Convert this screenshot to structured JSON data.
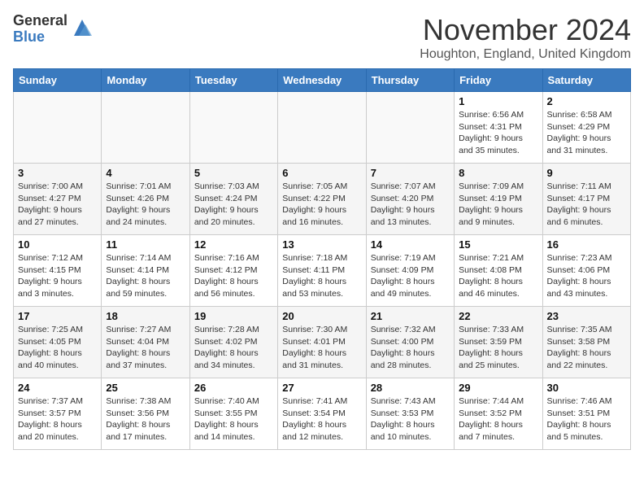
{
  "logo": {
    "general": "General",
    "blue": "Blue"
  },
  "title": "November 2024",
  "location": "Houghton, England, United Kingdom",
  "headers": [
    "Sunday",
    "Monday",
    "Tuesday",
    "Wednesday",
    "Thursday",
    "Friday",
    "Saturday"
  ],
  "weeks": [
    [
      {
        "day": "",
        "info": ""
      },
      {
        "day": "",
        "info": ""
      },
      {
        "day": "",
        "info": ""
      },
      {
        "day": "",
        "info": ""
      },
      {
        "day": "",
        "info": ""
      },
      {
        "day": "1",
        "info": "Sunrise: 6:56 AM\nSunset: 4:31 PM\nDaylight: 9 hours and 35 minutes."
      },
      {
        "day": "2",
        "info": "Sunrise: 6:58 AM\nSunset: 4:29 PM\nDaylight: 9 hours and 31 minutes."
      }
    ],
    [
      {
        "day": "3",
        "info": "Sunrise: 7:00 AM\nSunset: 4:27 PM\nDaylight: 9 hours and 27 minutes."
      },
      {
        "day": "4",
        "info": "Sunrise: 7:01 AM\nSunset: 4:26 PM\nDaylight: 9 hours and 24 minutes."
      },
      {
        "day": "5",
        "info": "Sunrise: 7:03 AM\nSunset: 4:24 PM\nDaylight: 9 hours and 20 minutes."
      },
      {
        "day": "6",
        "info": "Sunrise: 7:05 AM\nSunset: 4:22 PM\nDaylight: 9 hours and 16 minutes."
      },
      {
        "day": "7",
        "info": "Sunrise: 7:07 AM\nSunset: 4:20 PM\nDaylight: 9 hours and 13 minutes."
      },
      {
        "day": "8",
        "info": "Sunrise: 7:09 AM\nSunset: 4:19 PM\nDaylight: 9 hours and 9 minutes."
      },
      {
        "day": "9",
        "info": "Sunrise: 7:11 AM\nSunset: 4:17 PM\nDaylight: 9 hours and 6 minutes."
      }
    ],
    [
      {
        "day": "10",
        "info": "Sunrise: 7:12 AM\nSunset: 4:15 PM\nDaylight: 9 hours and 3 minutes."
      },
      {
        "day": "11",
        "info": "Sunrise: 7:14 AM\nSunset: 4:14 PM\nDaylight: 8 hours and 59 minutes."
      },
      {
        "day": "12",
        "info": "Sunrise: 7:16 AM\nSunset: 4:12 PM\nDaylight: 8 hours and 56 minutes."
      },
      {
        "day": "13",
        "info": "Sunrise: 7:18 AM\nSunset: 4:11 PM\nDaylight: 8 hours and 53 minutes."
      },
      {
        "day": "14",
        "info": "Sunrise: 7:19 AM\nSunset: 4:09 PM\nDaylight: 8 hours and 49 minutes."
      },
      {
        "day": "15",
        "info": "Sunrise: 7:21 AM\nSunset: 4:08 PM\nDaylight: 8 hours and 46 minutes."
      },
      {
        "day": "16",
        "info": "Sunrise: 7:23 AM\nSunset: 4:06 PM\nDaylight: 8 hours and 43 minutes."
      }
    ],
    [
      {
        "day": "17",
        "info": "Sunrise: 7:25 AM\nSunset: 4:05 PM\nDaylight: 8 hours and 40 minutes."
      },
      {
        "day": "18",
        "info": "Sunrise: 7:27 AM\nSunset: 4:04 PM\nDaylight: 8 hours and 37 minutes."
      },
      {
        "day": "19",
        "info": "Sunrise: 7:28 AM\nSunset: 4:02 PM\nDaylight: 8 hours and 34 minutes."
      },
      {
        "day": "20",
        "info": "Sunrise: 7:30 AM\nSunset: 4:01 PM\nDaylight: 8 hours and 31 minutes."
      },
      {
        "day": "21",
        "info": "Sunrise: 7:32 AM\nSunset: 4:00 PM\nDaylight: 8 hours and 28 minutes."
      },
      {
        "day": "22",
        "info": "Sunrise: 7:33 AM\nSunset: 3:59 PM\nDaylight: 8 hours and 25 minutes."
      },
      {
        "day": "23",
        "info": "Sunrise: 7:35 AM\nSunset: 3:58 PM\nDaylight: 8 hours and 22 minutes."
      }
    ],
    [
      {
        "day": "24",
        "info": "Sunrise: 7:37 AM\nSunset: 3:57 PM\nDaylight: 8 hours and 20 minutes."
      },
      {
        "day": "25",
        "info": "Sunrise: 7:38 AM\nSunset: 3:56 PM\nDaylight: 8 hours and 17 minutes."
      },
      {
        "day": "26",
        "info": "Sunrise: 7:40 AM\nSunset: 3:55 PM\nDaylight: 8 hours and 14 minutes."
      },
      {
        "day": "27",
        "info": "Sunrise: 7:41 AM\nSunset: 3:54 PM\nDaylight: 8 hours and 12 minutes."
      },
      {
        "day": "28",
        "info": "Sunrise: 7:43 AM\nSunset: 3:53 PM\nDaylight: 8 hours and 10 minutes."
      },
      {
        "day": "29",
        "info": "Sunrise: 7:44 AM\nSunset: 3:52 PM\nDaylight: 8 hours and 7 minutes."
      },
      {
        "day": "30",
        "info": "Sunrise: 7:46 AM\nSunset: 3:51 PM\nDaylight: 8 hours and 5 minutes."
      }
    ]
  ]
}
